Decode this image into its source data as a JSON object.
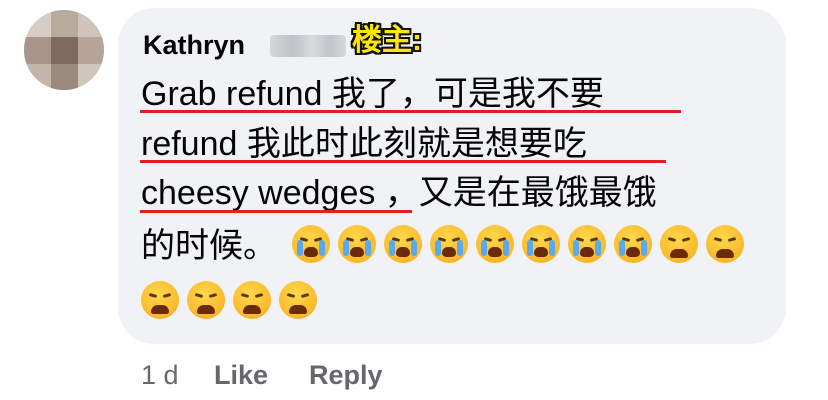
{
  "comment": {
    "author_name": "Kathryn",
    "op_label": "楼主:",
    "lines": [
      "Grab refund 我了，可是我不要",
      "refund 我此时此刻就是想要吃",
      "cheesy wedges ，又是在最饿最饿",
      "的时候。"
    ],
    "emojis_line4": [
      "loudly-crying-face",
      "loudly-crying-face",
      "loudly-crying-face",
      "loudly-crying-face",
      "loudly-crying-face",
      "loudly-crying-face",
      "loudly-crying-face",
      "loudly-crying-face",
      "weary-face",
      "weary-face"
    ],
    "emojis_line5": [
      "weary-face",
      "weary-face",
      "weary-face",
      "weary-face"
    ]
  },
  "actions": {
    "time": "1 d",
    "like_label": "Like",
    "reply_label": "Reply"
  },
  "colors": {
    "bubble": "#f0f2f5",
    "text": "#050505",
    "muted": "#65676b",
    "underline": "#e02020",
    "op_label": "#ffe600"
  }
}
